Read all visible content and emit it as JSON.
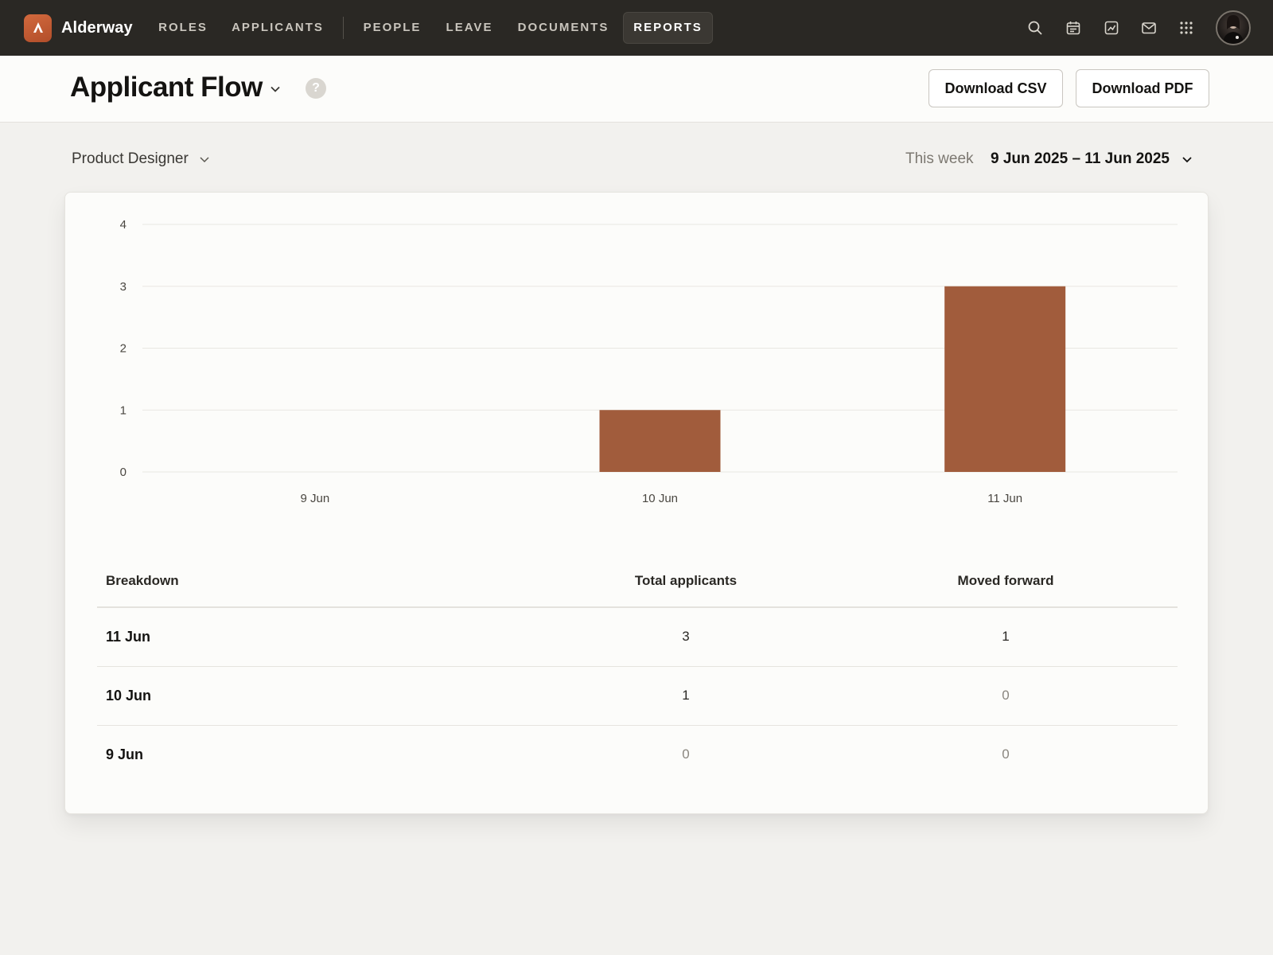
{
  "app": {
    "name": "Alderway"
  },
  "nav": {
    "items": [
      {
        "label": "ROLES"
      },
      {
        "label": "APPLICANTS"
      },
      {
        "label": "PEOPLE"
      },
      {
        "label": "LEAVE"
      },
      {
        "label": "DOCUMENTS"
      },
      {
        "label": "REPORTS",
        "active": true
      }
    ],
    "icons": [
      "search-icon",
      "calendar-icon",
      "chart-icon",
      "mail-icon",
      "apps-grid-icon"
    ]
  },
  "header": {
    "title": "Applicant Flow",
    "help": "?",
    "download_csv": "Download CSV",
    "download_pdf": "Download PDF"
  },
  "filters": {
    "role": "Product Designer",
    "period": "This week",
    "date_range": "9 Jun 2025 – 11 Jun 2025"
  },
  "colors": {
    "accent": "#a15c3c",
    "nav_bg": "#2a2824",
    "logo": "#c45c33"
  },
  "chart_data": {
    "type": "bar",
    "categories": [
      "9 Jun",
      "10 Jun",
      "11 Jun"
    ],
    "values": [
      0,
      1,
      3
    ],
    "ylim": [
      0,
      4
    ],
    "yticks": [
      0,
      1,
      2,
      3,
      4
    ],
    "grid": true,
    "title": "",
    "xlabel": "",
    "ylabel": ""
  },
  "table": {
    "headers": {
      "breakdown": "Breakdown",
      "total": "Total applicants",
      "moved": "Moved forward"
    },
    "rows": [
      {
        "date": "11 Jun",
        "total": "3",
        "moved": "1"
      },
      {
        "date": "10 Jun",
        "total": "1",
        "moved": "0"
      },
      {
        "date": "9 Jun",
        "total": "0",
        "moved": "0"
      }
    ]
  }
}
